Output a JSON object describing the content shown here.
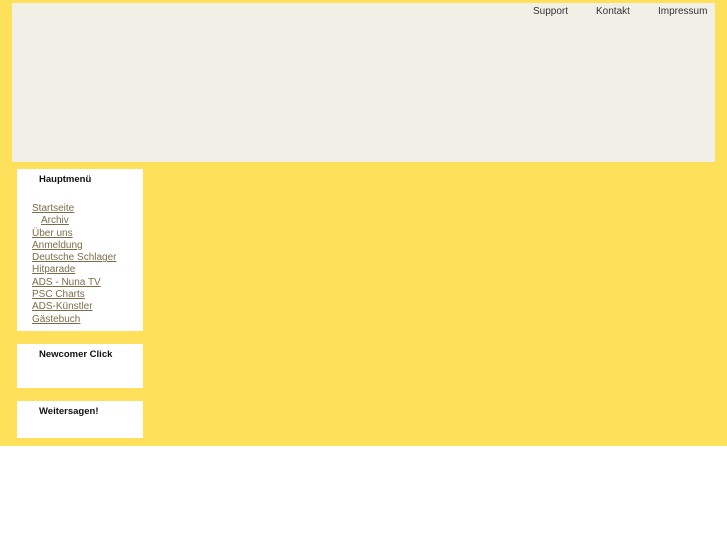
{
  "top_nav": [
    "Support",
    "Kontakt",
    "Impressum"
  ],
  "main_menu": {
    "title": "Hauptmenü",
    "items": [
      "Startseite",
      "Archiv",
      "Über uns",
      "Anmeldung",
      "Deutsche Schlager Hitparade",
      "ADS - Nuna TV",
      "PSC Charts",
      "ADS-Künstler",
      "Gästebuch"
    ]
  },
  "newcomer": {
    "title": "Newcomer Click"
  },
  "share": {
    "title": "Weitersagen!"
  }
}
